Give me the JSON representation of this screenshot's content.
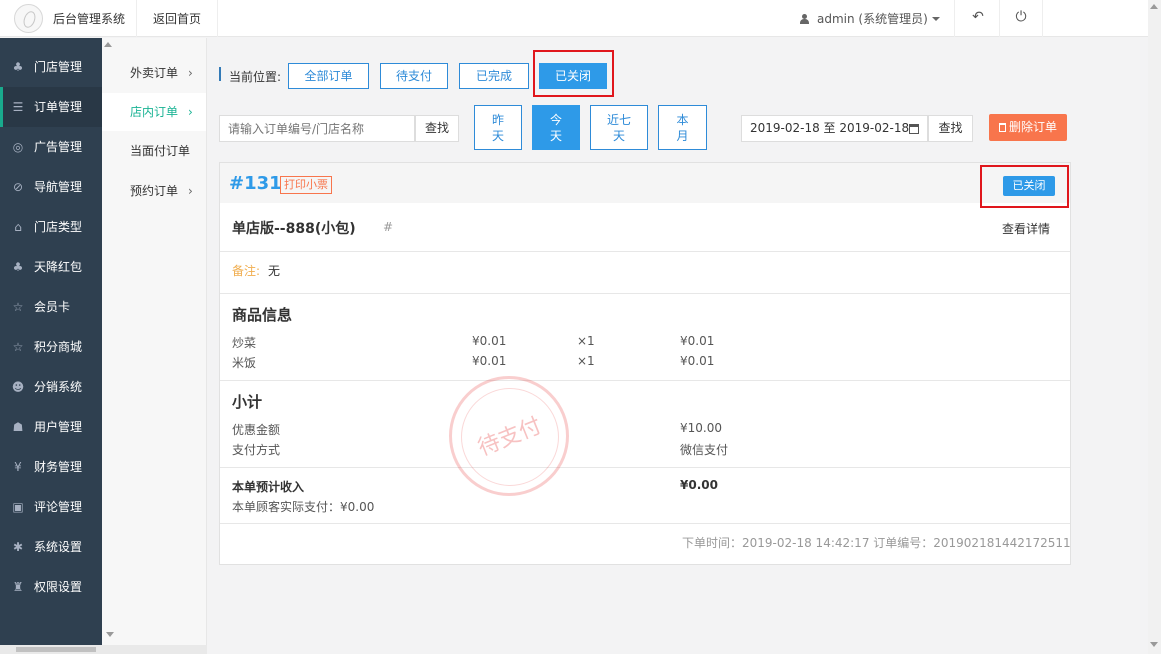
{
  "header": {
    "system_title": "后台管理系统",
    "back_home": "返回首页",
    "user_label": "admin (系统管理员)",
    "back_icon": "↶",
    "power_icon": "⏻"
  },
  "sidebar": {
    "items": [
      {
        "label": "门店管理",
        "icon": "♣"
      },
      {
        "label": "订单管理",
        "icon": "☰"
      },
      {
        "label": "广告管理",
        "icon": "◎"
      },
      {
        "label": "导航管理",
        "icon": "⊘"
      },
      {
        "label": "门店类型",
        "icon": "⌂"
      },
      {
        "label": "天降红包",
        "icon": "♣"
      },
      {
        "label": "会员卡",
        "icon": "☆"
      },
      {
        "label": "积分商城",
        "icon": "☆"
      },
      {
        "label": "分销系统",
        "icon": "☻"
      },
      {
        "label": "用户管理",
        "icon": "☗"
      },
      {
        "label": "财务管理",
        "icon": "¥"
      },
      {
        "label": "评论管理",
        "icon": "▣"
      },
      {
        "label": "系统设置",
        "icon": "✱"
      },
      {
        "label": "权限设置",
        "icon": "♜"
      }
    ]
  },
  "subnav": {
    "items": [
      {
        "label": "外卖订单"
      },
      {
        "label": "店内订单"
      },
      {
        "label": "当面付订单"
      },
      {
        "label": "预约订单"
      }
    ],
    "chevron": "›"
  },
  "filter": {
    "location_label": "当前位置:",
    "status_buttons": [
      "全部订单",
      "待支付",
      "已完成",
      "已关闭"
    ],
    "search_placeholder": "请输入订单编号/门店名称",
    "search_label": "查找",
    "date_buttons": [
      {
        "line1": "昨",
        "line2": "天"
      },
      {
        "line1": "今",
        "line2": "天"
      },
      {
        "line1": "近七",
        "line2": "天"
      },
      {
        "line1": "本",
        "line2": "月"
      }
    ],
    "date_range": "2019-02-18 至 2019-02-18",
    "date_search_label": "查找",
    "delete_label": "删除订单"
  },
  "order": {
    "number": "#131",
    "print_label": "打印小票",
    "status_badge": "已关闭",
    "store_name": "单店版--888(小包)",
    "hash": "#",
    "view_detail": "查看详情",
    "remark_label": "备注:",
    "remark_value": "无",
    "goods_title": "商品信息",
    "goods": [
      {
        "name": "炒菜",
        "price": "¥0.01",
        "qty": "×1",
        "total": "¥0.01"
      },
      {
        "name": "米饭",
        "price": "¥0.01",
        "qty": "×1",
        "total": "¥0.01"
      }
    ],
    "subtotal_title": "小计",
    "discount_label": "优惠金额",
    "discount_value": "¥10.00",
    "pay_method_label": "支付方式",
    "pay_method_value": "微信支付",
    "income_label": "本单预计收入",
    "income_value": "¥0.00",
    "actual_paid": "本单顾客实际支付：¥0.00",
    "stamp_text": "待支付",
    "footer": "下单时间：2019-02-18 14:42:17    订单编号：201902181442172511"
  }
}
